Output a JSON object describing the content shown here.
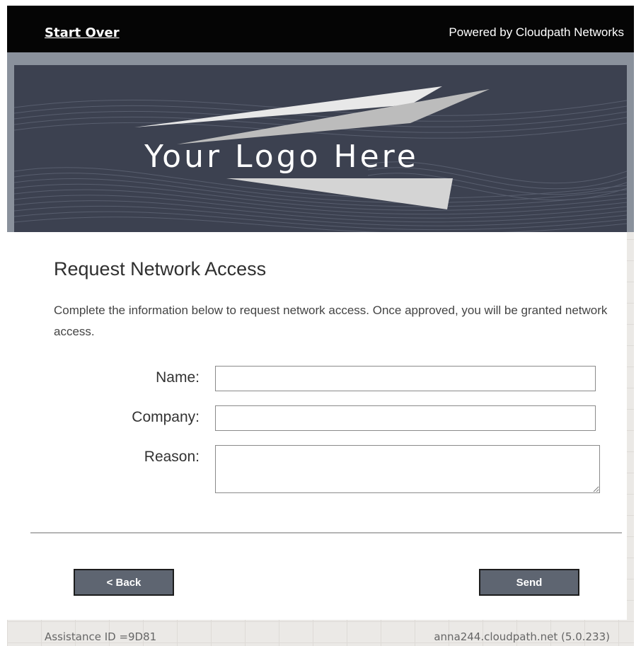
{
  "header": {
    "start_over": "Start Over",
    "powered_by": "Powered by Cloudpath Networks"
  },
  "banner": {
    "logo_text": "Your Logo Here"
  },
  "form": {
    "title": "Request Network Access",
    "description": "Complete the information below to request network access. Once approved, you will be granted network access.",
    "fields": [
      {
        "label": "Name:",
        "value": "",
        "placeholder": ""
      },
      {
        "label": "Company:",
        "value": "",
        "placeholder": ""
      },
      {
        "label": "Reason:",
        "value": "",
        "placeholder": ""
      }
    ],
    "back_button": "< Back",
    "send_button": "Send"
  },
  "footer": {
    "assistance_id": "Assistance ID =9D81",
    "host": "anna244.cloudpath.net (5.0.233)"
  },
  "colors": {
    "topbar": "#050505",
    "banner": "#3c4150",
    "button": "#5e6571"
  }
}
